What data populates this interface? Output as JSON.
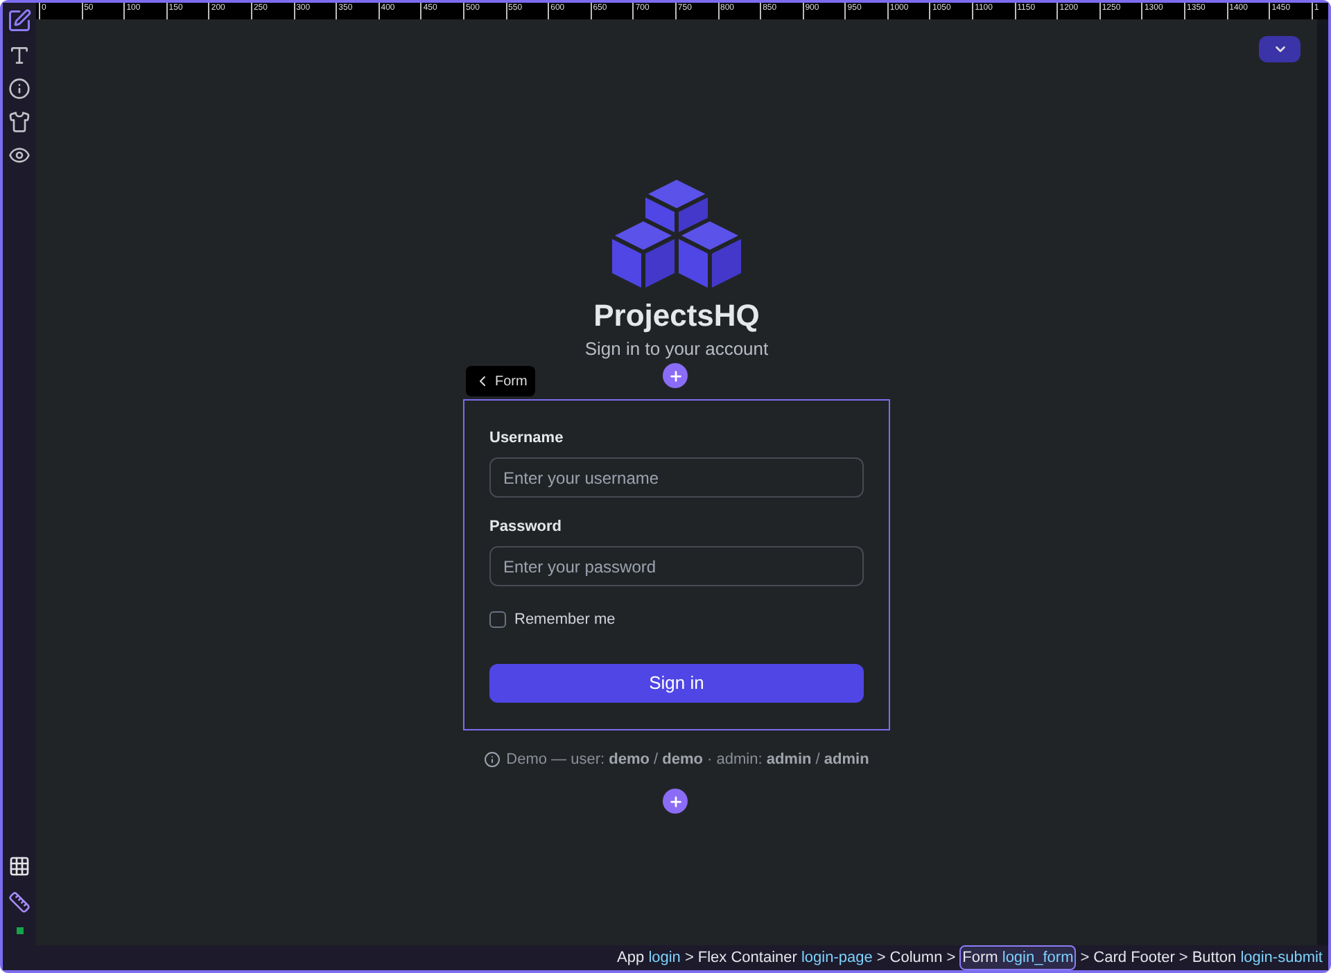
{
  "ruler": {
    "labels": [
      "0",
      "50",
      "100",
      "150",
      "200",
      "250",
      "300",
      "350",
      "400",
      "450",
      "500",
      "550",
      "600",
      "650",
      "700",
      "750",
      "800",
      "850",
      "900",
      "950",
      "1000",
      "1050",
      "1100",
      "1150",
      "1200",
      "1250",
      "1300",
      "1350",
      "1400",
      "1450",
      "1"
    ]
  },
  "sidebar": {
    "tools": [
      {
        "kind": "edit",
        "selected": true
      },
      {
        "kind": "text",
        "selected": false
      },
      {
        "kind": "info",
        "selected": false
      },
      {
        "kind": "shirt",
        "selected": false
      },
      {
        "kind": "eye",
        "selected": false
      }
    ],
    "bottom_tools": [
      {
        "kind": "grid"
      },
      {
        "kind": "ruler"
      },
      {
        "kind": "status",
        "color": "#16a34a"
      }
    ]
  },
  "brand": {
    "title": "ProjectsHQ",
    "subtitle": "Sign in to your account"
  },
  "selection_tag": {
    "label": "Form"
  },
  "form": {
    "fields": [
      {
        "label": "Username",
        "placeholder": "Enter your username"
      },
      {
        "label": "Password",
        "placeholder": "Enter your password"
      }
    ],
    "remember": {
      "label": "Remember me",
      "checked": false
    },
    "submit": "Sign in"
  },
  "demo_note": "Demo — user: **demo** / **demo** · admin: **admin** / **admin**",
  "breadcrumb": [
    {
      "type": "App",
      "id": "login",
      "selected": false
    },
    {
      "separator": ">",
      "type": "Flex Container",
      "id": "login-page",
      "selected": false
    },
    {
      "separator": ">",
      "type": "Column",
      "selected": false
    },
    {
      "separator": ">",
      "type": "Form",
      "id": "login_form",
      "selected": true
    },
    {
      "separator": ">",
      "type": "Card Footer",
      "selected": false
    },
    {
      "separator": ">",
      "type": "Button",
      "id": "login-submit",
      "selected": false
    }
  ]
}
